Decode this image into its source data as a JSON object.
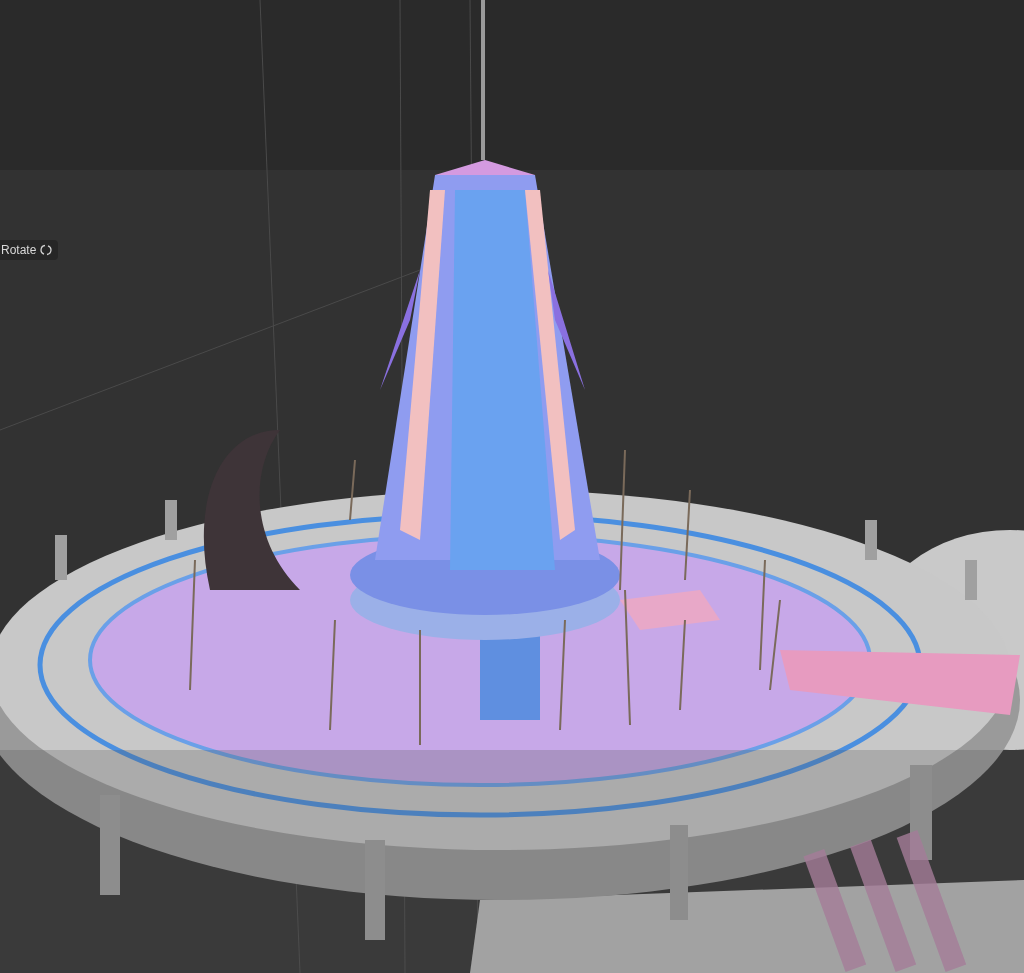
{
  "viewport": {
    "rotate_button": {
      "label": "Rotate"
    }
  }
}
